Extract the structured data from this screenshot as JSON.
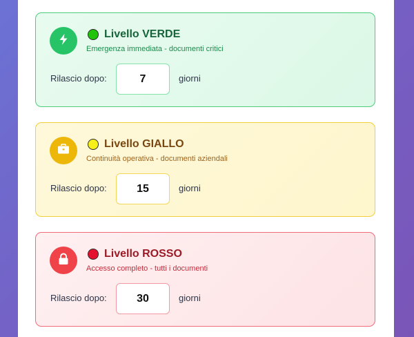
{
  "levels": [
    {
      "color_key": "green",
      "dot_color": "#22c40b",
      "badge_icon": "lightning-bolt-icon",
      "title": "Livello VERDE",
      "subtitle": "Emergenza immediata - documenti critici",
      "release_label": "Rilascio dopo:",
      "days_value": "7",
      "unit_label": "giorni"
    },
    {
      "color_key": "yellow",
      "dot_color": "#f7ef1a",
      "badge_icon": "briefcase-icon",
      "title": "Livello GIALLO",
      "subtitle": "Continuità operativa - documenti aziendali",
      "release_label": "Rilascio dopo:",
      "days_value": "15",
      "unit_label": "giorni"
    },
    {
      "color_key": "red",
      "dot_color": "#e4122f",
      "badge_icon": "padlock-icon",
      "title": "Livello ROSSO",
      "subtitle": "Accesso completo - tutti i documenti",
      "release_label": "Rilascio dopo:",
      "days_value": "30",
      "unit_label": "giorni"
    }
  ]
}
